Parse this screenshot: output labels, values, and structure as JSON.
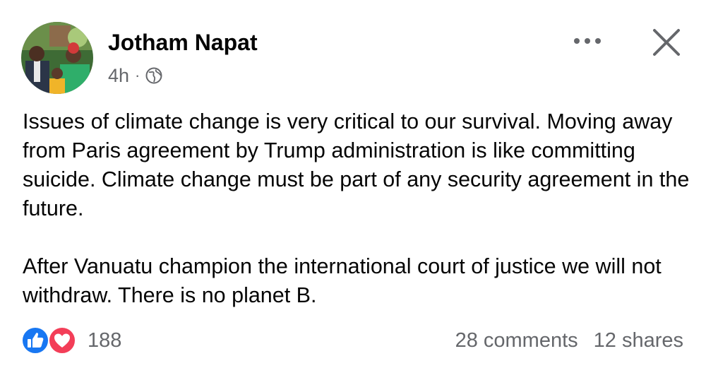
{
  "post": {
    "author": {
      "name": "Jotham Napat"
    },
    "meta": {
      "time": "4h",
      "separator": "·",
      "audience_icon": "globe-icon"
    },
    "actions": {
      "more_icon": "more-horizontal-icon",
      "close_icon": "close-icon"
    },
    "body": {
      "paragraph_1": "Issues of climate change is very critical to our survival. Moving away from Paris agreement by Trump administration is like committing suicide.  Climate change must be part of any security agreement in the future.",
      "paragraph_2": "After Vanuatu champion the international court of justice we will not withdraw.  There is no planet B."
    },
    "reactions": {
      "icons": [
        "like-icon",
        "love-icon"
      ],
      "count": "188"
    },
    "stats": {
      "comments": "28 comments",
      "shares": "12 shares"
    }
  },
  "colors": {
    "text_primary": "#050505",
    "text_secondary": "#65676b",
    "like_blue": "#1877f2",
    "love_red": "#f33e58"
  }
}
